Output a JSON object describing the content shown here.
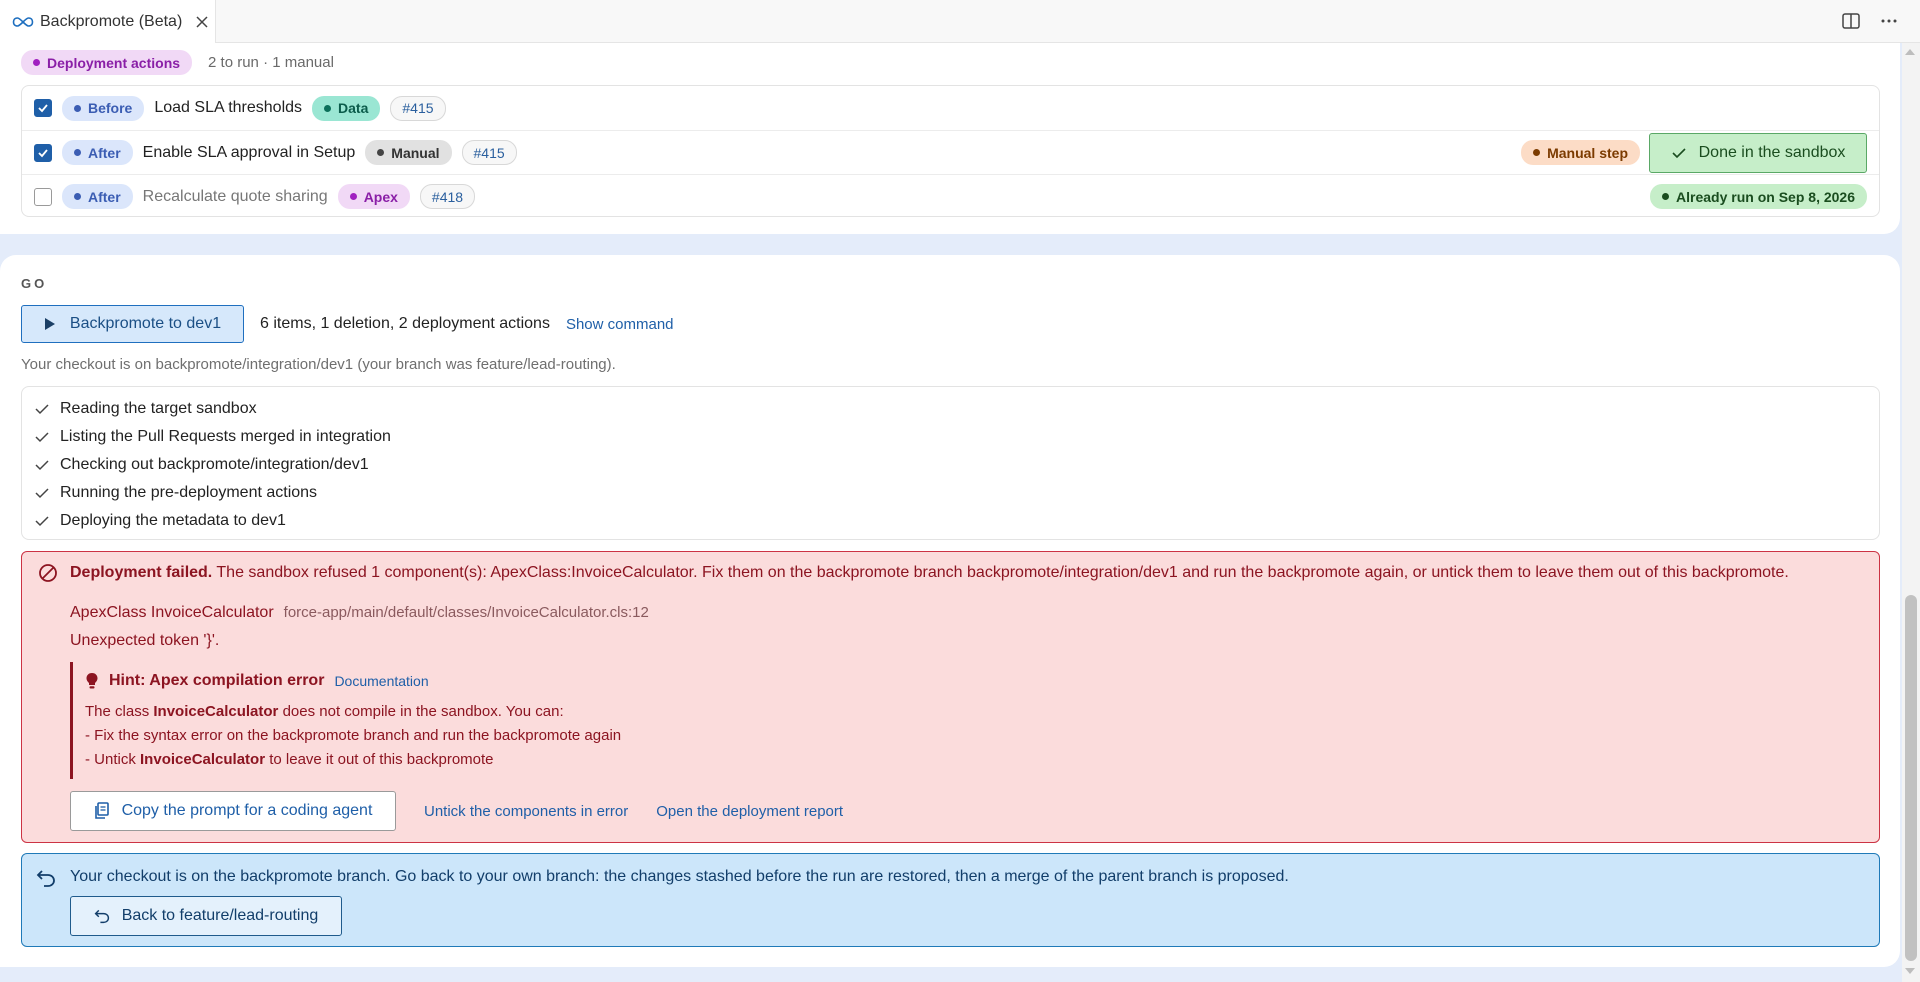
{
  "tab": {
    "title": "Backpromote (Beta)"
  },
  "deployment_actions": {
    "label": "Deployment actions",
    "summary": "2 to run · 1 manual",
    "rows": [
      {
        "phase": "Before",
        "title": "Load SLA thresholds",
        "type": "Data",
        "pr": "#415",
        "checked": true
      },
      {
        "phase": "After",
        "title": "Enable SLA approval in Setup",
        "type": "Manual",
        "pr": "#415",
        "checked": true,
        "badge": "Manual step",
        "button": "Done in the sandbox"
      },
      {
        "phase": "After",
        "title": "Recalculate quote sharing",
        "type": "Apex",
        "pr": "#418",
        "checked": false,
        "status": "Already run on Sep 8, 2026"
      }
    ]
  },
  "go": {
    "title": "GO",
    "run_button": "Backpromote to dev1",
    "summary": "6 items, 1 deletion, 2 deployment actions",
    "show_command": "Show command",
    "checkout_note": "Your checkout is on backpromote/integration/dev1 (your branch was feature/lead-routing).",
    "steps": [
      "Reading the target sandbox",
      "Listing the Pull Requests merged in integration",
      "Checking out backpromote/integration/dev1",
      "Running the pre-deployment actions",
      "Deploying the metadata to dev1"
    ]
  },
  "error": {
    "title": "Deployment failed.",
    "message": "The sandbox refused 1 component(s): ApexClass:InvoiceCalculator. Fix them on the backpromote branch backpromote/integration/dev1 and run the backpromote again, or untick them to leave them out of this backpromote.",
    "component": "ApexClass InvoiceCalculator",
    "path": "force-app/main/default/classes/InvoiceCalculator.cls:12",
    "detail": "Unexpected token '}'.",
    "hint": {
      "title": "Hint: Apex compilation error",
      "doc_link": "Documentation",
      "line1_pre": "The class ",
      "line1_bold": "InvoiceCalculator",
      "line1_post": " does not compile in the sandbox. You can:",
      "line2": "- Fix the syntax error on the backpromote branch and run the backpromote again",
      "line3_pre": "- Untick ",
      "line3_bold": "InvoiceCalculator",
      "line3_post": " to leave it out of this backpromote"
    },
    "copy_button": "Copy the prompt for a coding agent",
    "untick_link": "Untick the components in error",
    "report_link": "Open the deployment report"
  },
  "info": {
    "message": "Your checkout is on the backpromote branch. Go back to your own branch: the changes stashed before the run are restored, then a merge of the parent branch is proposed.",
    "back_button": "Back to feature/lead-routing"
  },
  "colors": {
    "accent": "#1f5fa8",
    "error_bg": "#fbdcdc",
    "error_border": "#cc3344",
    "info_bg": "#cce6fa",
    "success_bg": "#c6eec9"
  },
  "icons": [
    "infinity-icon",
    "close-icon",
    "split-editor-icon",
    "more-icon",
    "check-icon",
    "play-icon",
    "error-icon",
    "lightbulb-icon",
    "copy-icon",
    "undo-icon"
  ]
}
